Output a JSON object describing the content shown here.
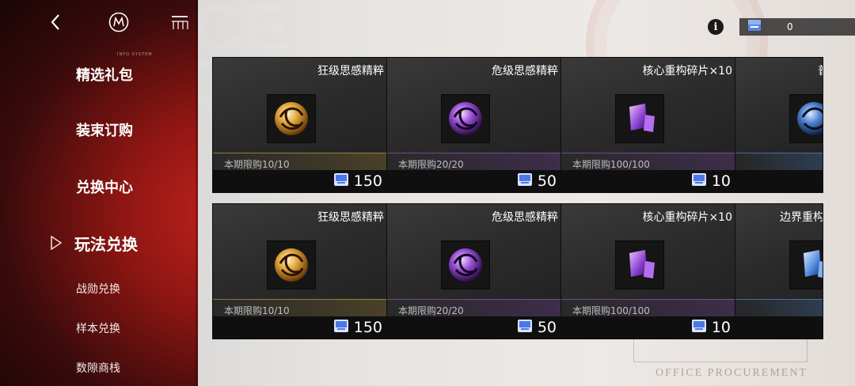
{
  "background": {
    "watermark_line1": "OFFICE",
    "watermark_line2": "PROCUREMENT",
    "footer_text": "OFFICE PROCUREMENT"
  },
  "topbar": {
    "back_icon": "chevron-left-icon",
    "logo_icon": "m-logo-icon",
    "menu_icon": "menu-icon",
    "system_caption": "INFO SYSTEM"
  },
  "sidebar": {
    "items": [
      {
        "label": "精选礼包",
        "type": "main",
        "active": false
      },
      {
        "label": "装束订购",
        "type": "main",
        "active": false
      },
      {
        "label": "兑换中心",
        "type": "main",
        "active": false
      },
      {
        "label": "玩法兑换",
        "type": "main",
        "active": true
      },
      {
        "label": "战勋兑换",
        "type": "sub",
        "active": false
      },
      {
        "label": "样本兑换",
        "type": "sub",
        "active": false
      },
      {
        "label": "数隙商栈",
        "type": "sub",
        "active": false
      }
    ]
  },
  "currency": {
    "icon": "ticket-icon",
    "amount": "0"
  },
  "colors": {
    "sidebar_red": "#c7231c",
    "gold": "#d6af46",
    "purple": "#aa64dc",
    "blue": "#5a96e6",
    "ticket_blue": "#3f6fe0"
  },
  "cards": [
    {
      "name": "狂级思感精粹",
      "limit": "本期限购10/10",
      "price": "150",
      "rarity": "gold",
      "icon": "gold-orb-icon"
    },
    {
      "name": "危级思感精粹",
      "limit": "本期限购20/20",
      "price": "50",
      "rarity": "purple",
      "icon": "purple-orb-icon"
    },
    {
      "name": "核心重构碎片×10",
      "limit": "本期限购100/100",
      "price": "10",
      "rarity": "purple",
      "icon": "purple-shard-icon"
    },
    {
      "name": "普",
      "limit": "",
      "price": "",
      "rarity": "blue",
      "icon": "blue-orb-icon"
    },
    {
      "name": "狂级思感精粹",
      "limit": "本期限购10/10",
      "price": "150",
      "rarity": "gold",
      "icon": "gold-orb-icon"
    },
    {
      "name": "危级思感精粹",
      "limit": "本期限购20/20",
      "price": "50",
      "rarity": "purple",
      "icon": "purple-orb-icon"
    },
    {
      "name": "核心重构碎片×10",
      "limit": "本期限购100/100",
      "price": "10",
      "rarity": "purple",
      "icon": "purple-shard-icon"
    },
    {
      "name": "边界重构",
      "limit": "",
      "price": "",
      "rarity": "blue",
      "icon": "blue-shard-icon"
    }
  ]
}
